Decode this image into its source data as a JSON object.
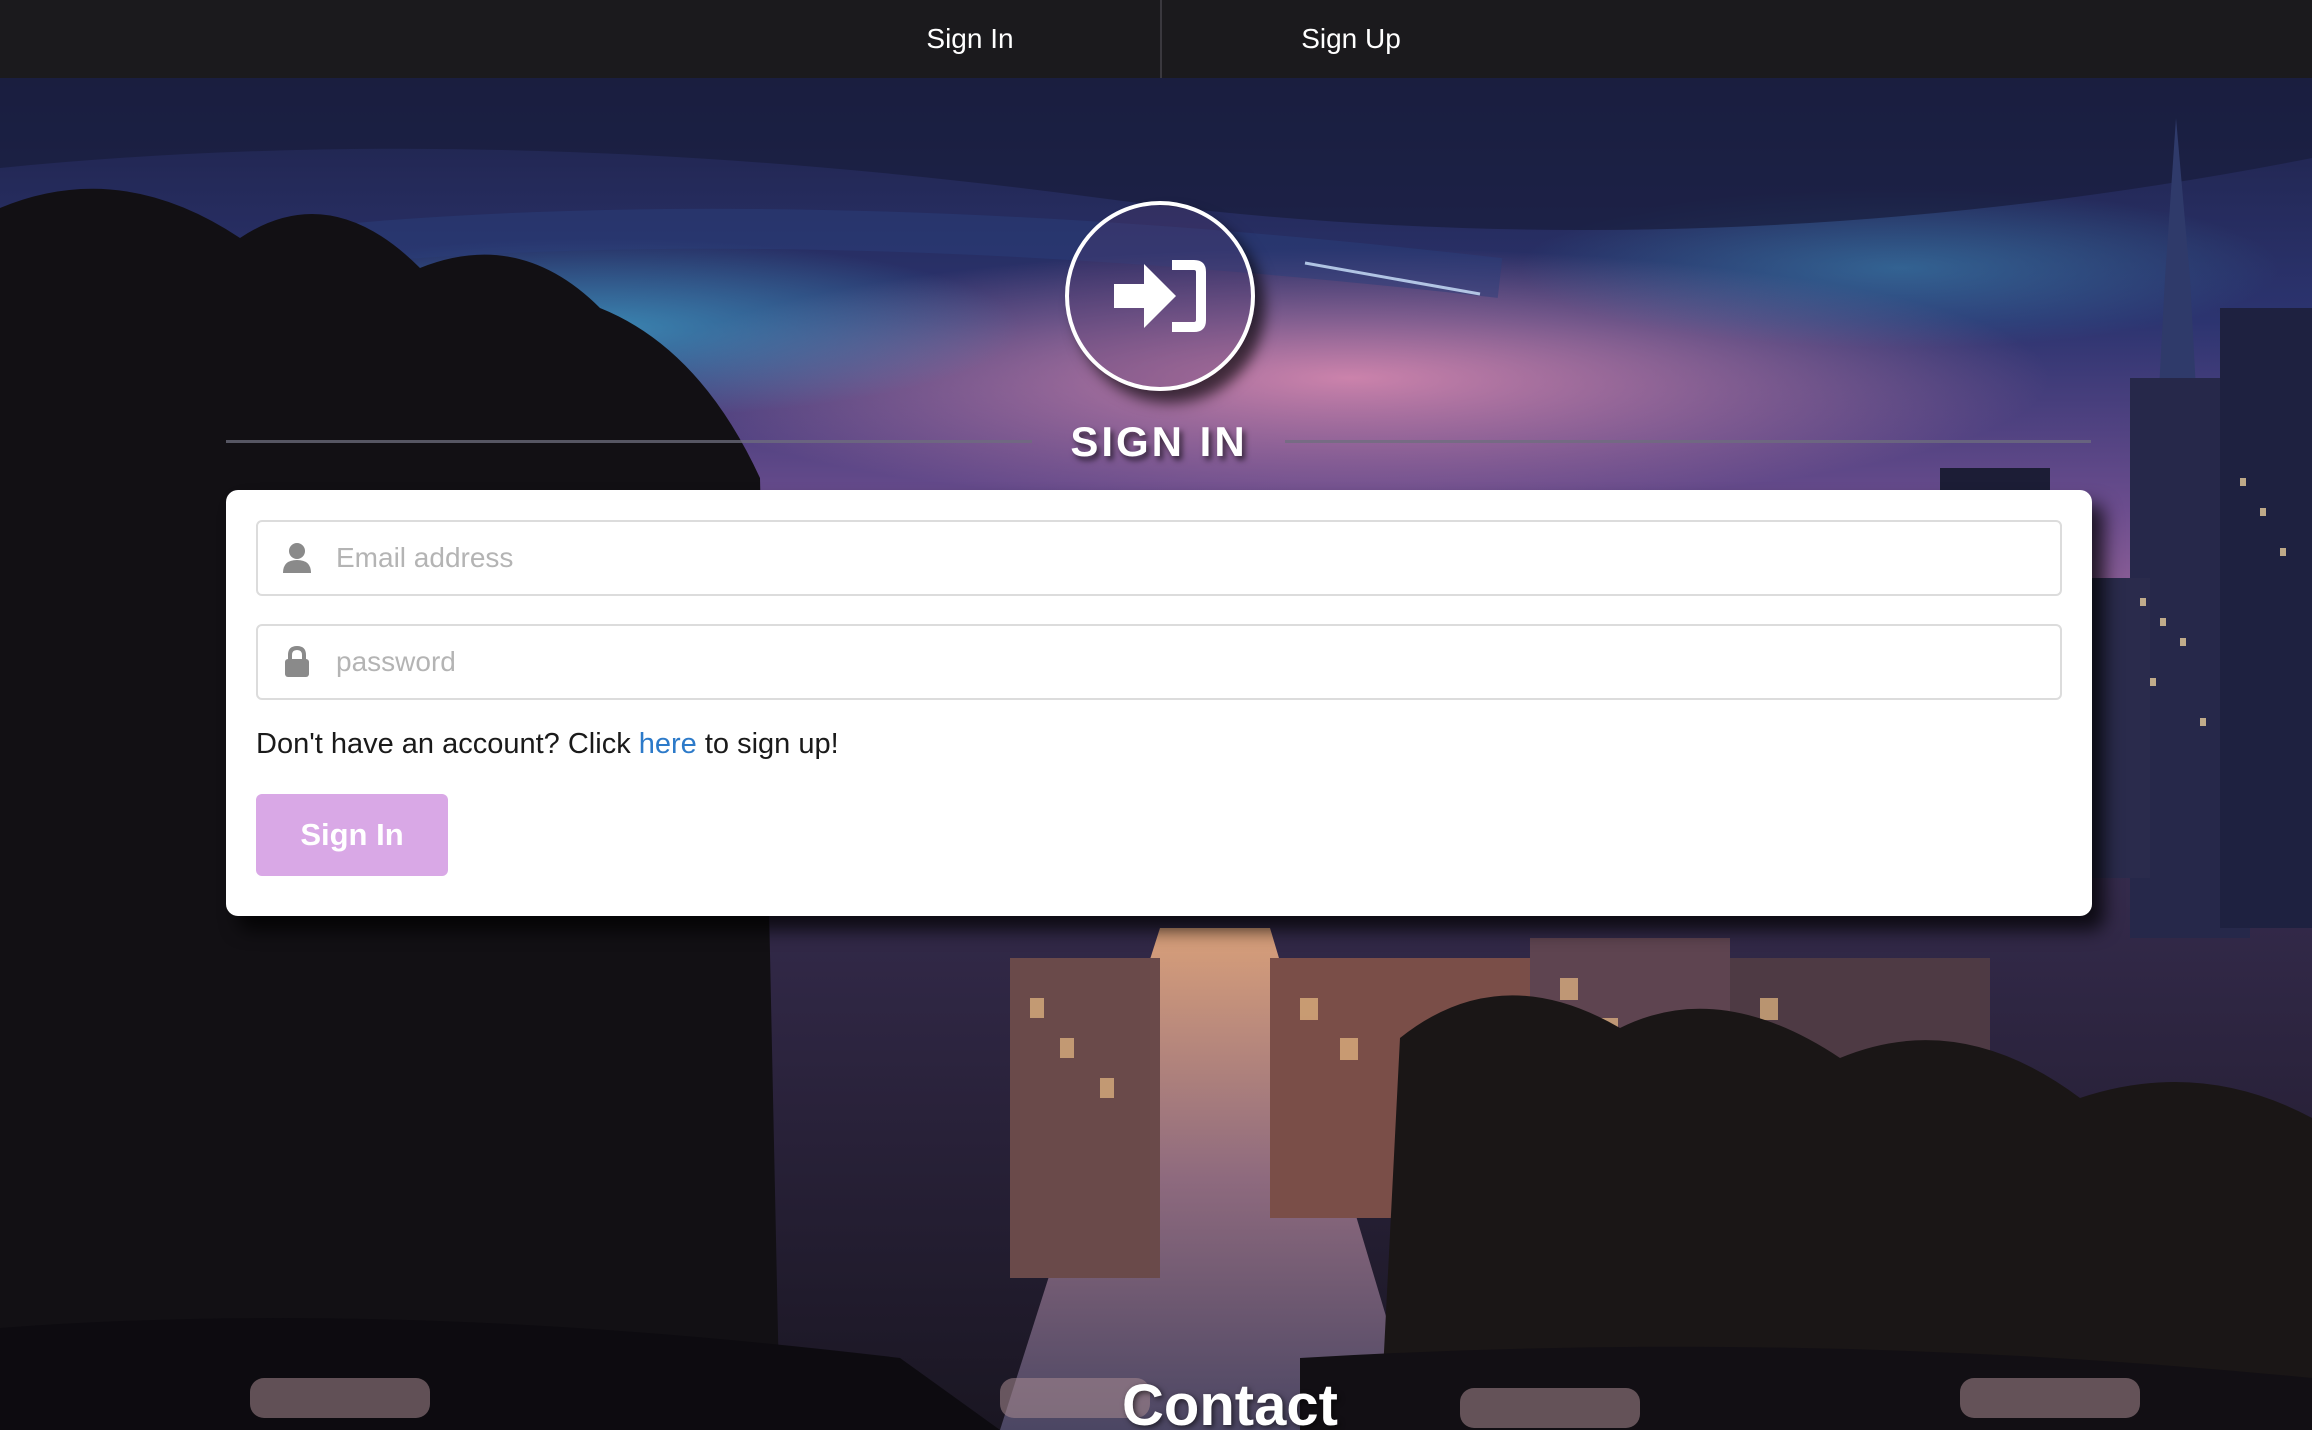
{
  "nav": {
    "signin_label": "Sign In",
    "signup_label": "Sign Up"
  },
  "header": {
    "icon": "sign-in-icon",
    "title": "SIGN IN"
  },
  "form": {
    "email": {
      "placeholder": "Email address",
      "value": "",
      "icon": "user-icon"
    },
    "password": {
      "placeholder": "password",
      "value": "",
      "icon": "lock-icon"
    },
    "signup_prompt": {
      "before": "Don't have an account? Click ",
      "link": "here",
      "after": " to sign up!"
    },
    "submit_label": "Sign In"
  },
  "footer": {
    "heading": "Contact"
  },
  "colors": {
    "navbar": "#1b1a1d",
    "button": "#d9a8e6",
    "link": "#2c7ac9",
    "card": "#ffffff"
  }
}
